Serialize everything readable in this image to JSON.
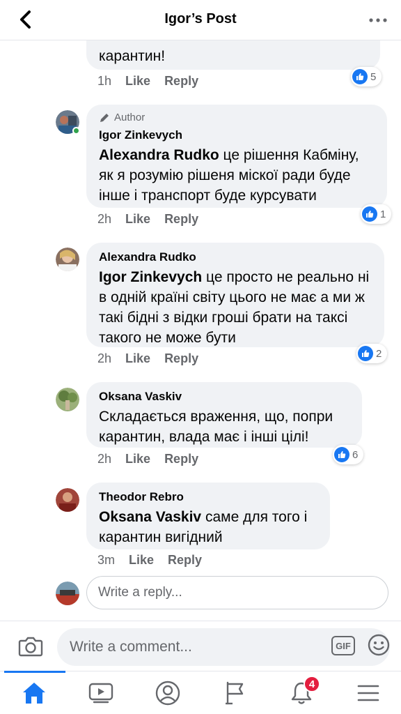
{
  "header": {
    "title": "Igor’s Post"
  },
  "comments": [
    {
      "text_tail": "карантин!",
      "time": "1h",
      "like_label": "Like",
      "reply_label": "Reply",
      "reactions": "5"
    },
    {
      "badge": "Author",
      "name": "Igor Zinkevych",
      "mention": "Alexandra Rudko",
      "text": " це рішення Кабміну, як я розумію рішеня міскої ради буде інше і транспорт буде курсувати",
      "time": "2h",
      "like_label": "Like",
      "reply_label": "Reply",
      "reactions": "1"
    },
    {
      "name": "Alexandra Rudko",
      "mention": "Igor Zinkevych",
      "text": " це просто не реально ні в одній країні світу цього не має а ми ж такі бідні з відки гроші брати на таксі такого не може бути",
      "time": "2h",
      "like_label": "Like",
      "reply_label": "Reply",
      "reactions": "2"
    },
    {
      "name": "Oksana Vaskiv",
      "text": "Складається враження, що, попри карантин, влада має і інші цілі!",
      "time": "2h",
      "like_label": "Like",
      "reply_label": "Reply",
      "reactions": "6"
    },
    {
      "name": "Theodor Rebro",
      "mention": "Oksana Vaskiv",
      "text": " саме для того і карантин вигідний",
      "time": "3m",
      "like_label": "Like",
      "reply_label": "Reply"
    }
  ],
  "reply_input": {
    "placeholder": "Write a reply..."
  },
  "composer": {
    "placeholder": "Write a comment...",
    "gif_label": "GIF"
  },
  "nav": {
    "notifications_count": "4"
  },
  "colors": {
    "accent": "#1877f2",
    "bubble": "#f0f2f5",
    "muted": "#65676b",
    "badge": "#e41e3f"
  }
}
